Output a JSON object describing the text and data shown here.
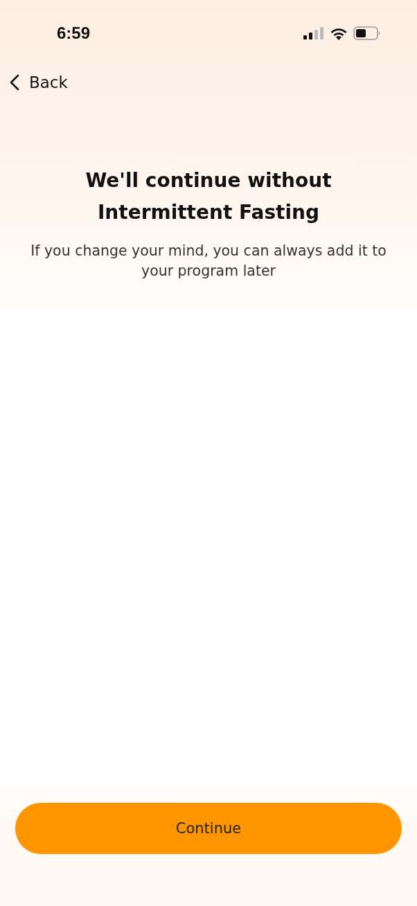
{
  "status_bar": {
    "time": "6:59"
  },
  "nav": {
    "back_label": "Back"
  },
  "title": "We'll continue without Intermittent Fasting",
  "subtitle": "If you change your mind, you can always add it to your program later",
  "primary_button": {
    "label": "Continue"
  }
}
